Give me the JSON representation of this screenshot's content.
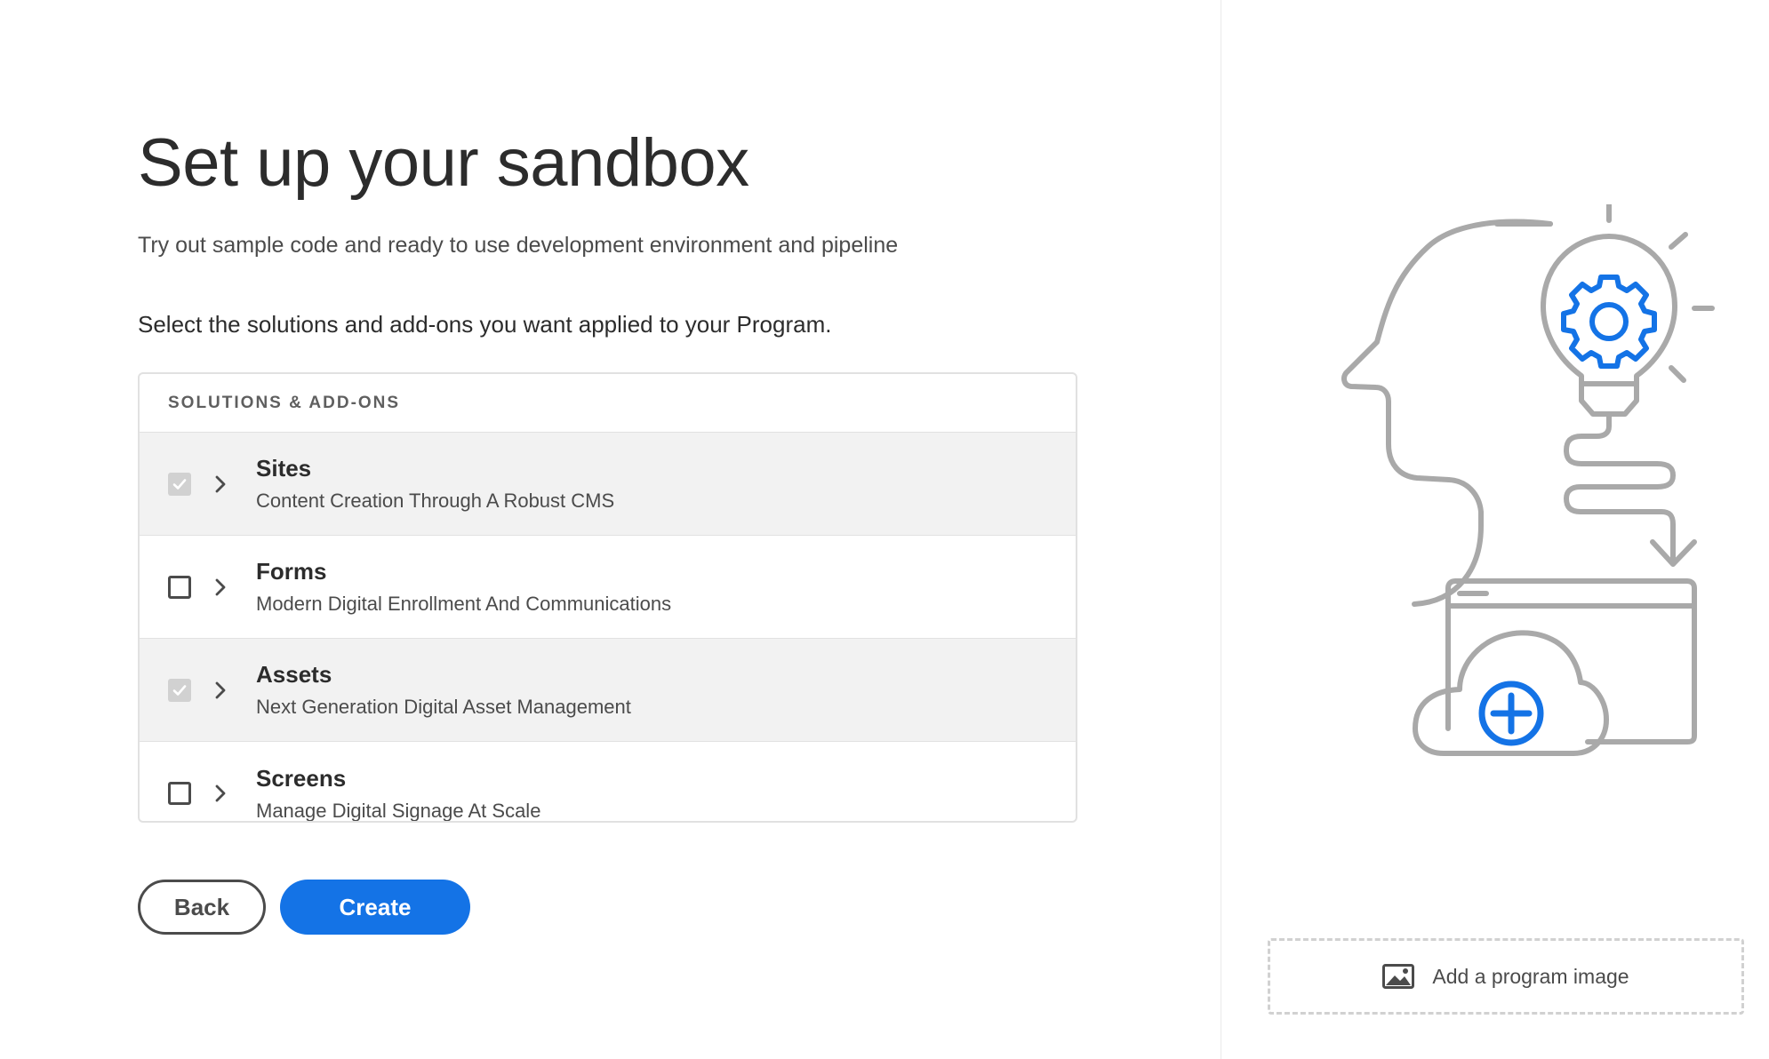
{
  "page": {
    "title": "Set up your sandbox",
    "subtitle": "Try out sample code and ready to use development environment and pipeline",
    "instruction": "Select the solutions and add-ons you want applied to your Program."
  },
  "solutions": {
    "header": "SOLUTIONS & ADD-ONS",
    "items": [
      {
        "title": "Sites",
        "description": "Content Creation Through A Robust CMS",
        "checked": true
      },
      {
        "title": "Forms",
        "description": "Modern Digital Enrollment And Communications",
        "checked": false
      },
      {
        "title": "Assets",
        "description": "Next Generation Digital Asset Management",
        "checked": true
      },
      {
        "title": "Screens",
        "description": "Manage Digital Signage At Scale",
        "checked": false
      }
    ]
  },
  "buttons": {
    "back": "Back",
    "create": "Create"
  },
  "sidebar": {
    "add_image_label": "Add a program image"
  },
  "icons": {
    "checkbox_checked": "checkmark-icon",
    "expand": "chevron-right-icon",
    "add_image": "image-icon",
    "illustration": "head-lightbulb-gear-cloud-illustration"
  },
  "colors": {
    "accent": "#1473e6",
    "illustration_gray": "#a9a9a9",
    "selected_row_bg": "#f2f2f2"
  }
}
